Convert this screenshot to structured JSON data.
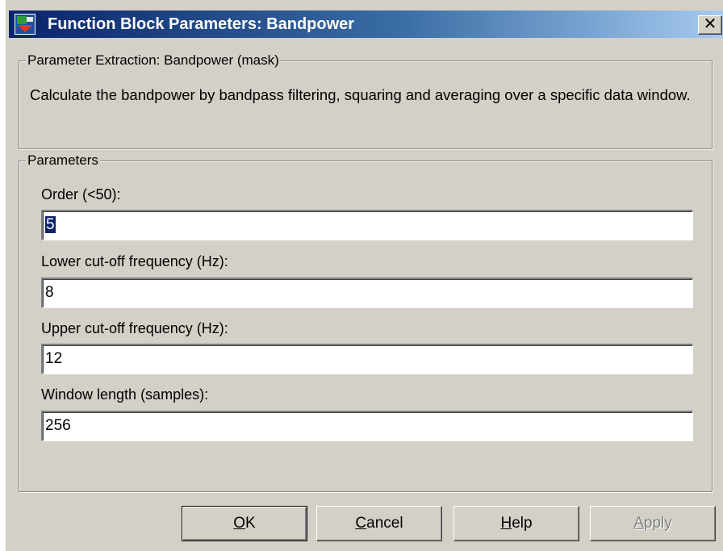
{
  "window": {
    "title": "Function Block Parameters: Bandpower",
    "close_glyph": "✕",
    "icon": "simulink-block-icon"
  },
  "mask": {
    "legend": "Parameter Extraction: Bandpower (mask)",
    "description": "Calculate the bandpower by bandpass filtering, squaring and averaging over a specific data window."
  },
  "parameters": {
    "legend": "Parameters",
    "fields": [
      {
        "label": "Order (<50):",
        "value": "5",
        "selected": true
      },
      {
        "label": "Lower cut-off frequency (Hz):",
        "value": "8"
      },
      {
        "label": "Upper cut-off frequency (Hz):",
        "value": "12"
      },
      {
        "label": "Window length (samples):",
        "value": "256"
      }
    ]
  },
  "buttons": {
    "ok": {
      "mnemonic": "O",
      "rest": "K"
    },
    "cancel": {
      "mnemonic": "C",
      "rest": "ancel"
    },
    "help": {
      "mnemonic": "H",
      "rest": "elp"
    },
    "apply": {
      "mnemonic": "A",
      "rest": "pply",
      "disabled": true
    }
  },
  "colors": {
    "titlebar_start": "#0a246a",
    "titlebar_end": "#a6caf0",
    "dialog_face": "#d4d0c8",
    "selection": "#0a246a"
  }
}
